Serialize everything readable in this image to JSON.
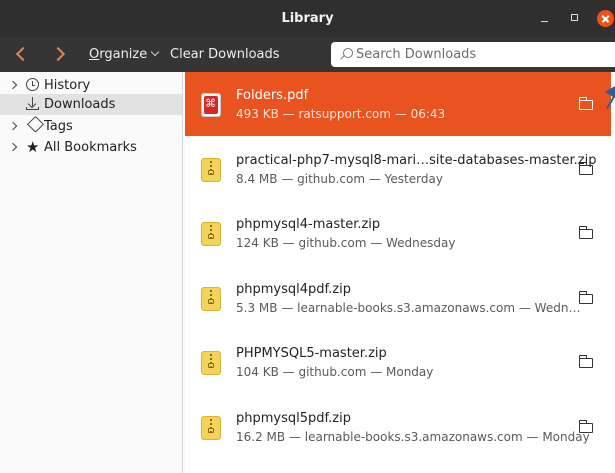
{
  "window": {
    "title": "Library"
  },
  "toolbar": {
    "organize_prefix": "O",
    "organize_rest": "rganize",
    "clear_label": "Clear Downloads",
    "search_placeholder": "Search Downloads"
  },
  "sidebar": {
    "items": [
      {
        "label": "History",
        "icon": "clock-icon"
      },
      {
        "label": "Downloads",
        "icon": "download-icon"
      },
      {
        "label": "Tags",
        "icon": "tag-icon"
      },
      {
        "label": "All Bookmarks",
        "icon": "star-icon"
      }
    ]
  },
  "downloads": [
    {
      "name": "Folders.pdf",
      "meta": "493 KB — ratsupport.com — 06:43",
      "type": "pdf",
      "selected": true
    },
    {
      "name": "practical-php7-mysql8-mari…site-databases-master.zip",
      "meta": "8.4 MB — github.com — Yesterday",
      "type": "zip"
    },
    {
      "name": "phpmysql4-master.zip",
      "meta": "124 KB — github.com — Wednesday",
      "type": "zip"
    },
    {
      "name": "phpmysql4pdf.zip",
      "meta": "5.3 MB — learnable-books.s3.amazonaws.com — Wedn…",
      "type": "zip"
    },
    {
      "name": "PHPMYSQL5-master.zip",
      "meta": "104 KB — github.com — Monday",
      "type": "zip"
    },
    {
      "name": "phpmysql5pdf.zip",
      "meta": "16.2 MB — learnable-books.s3.amazonaws.com — Monday",
      "type": "zip"
    }
  ],
  "colors": {
    "accent": "#e9531f",
    "titlebar": "#2f2f2f",
    "toolbar": "#353535",
    "close": "#e9541c"
  }
}
